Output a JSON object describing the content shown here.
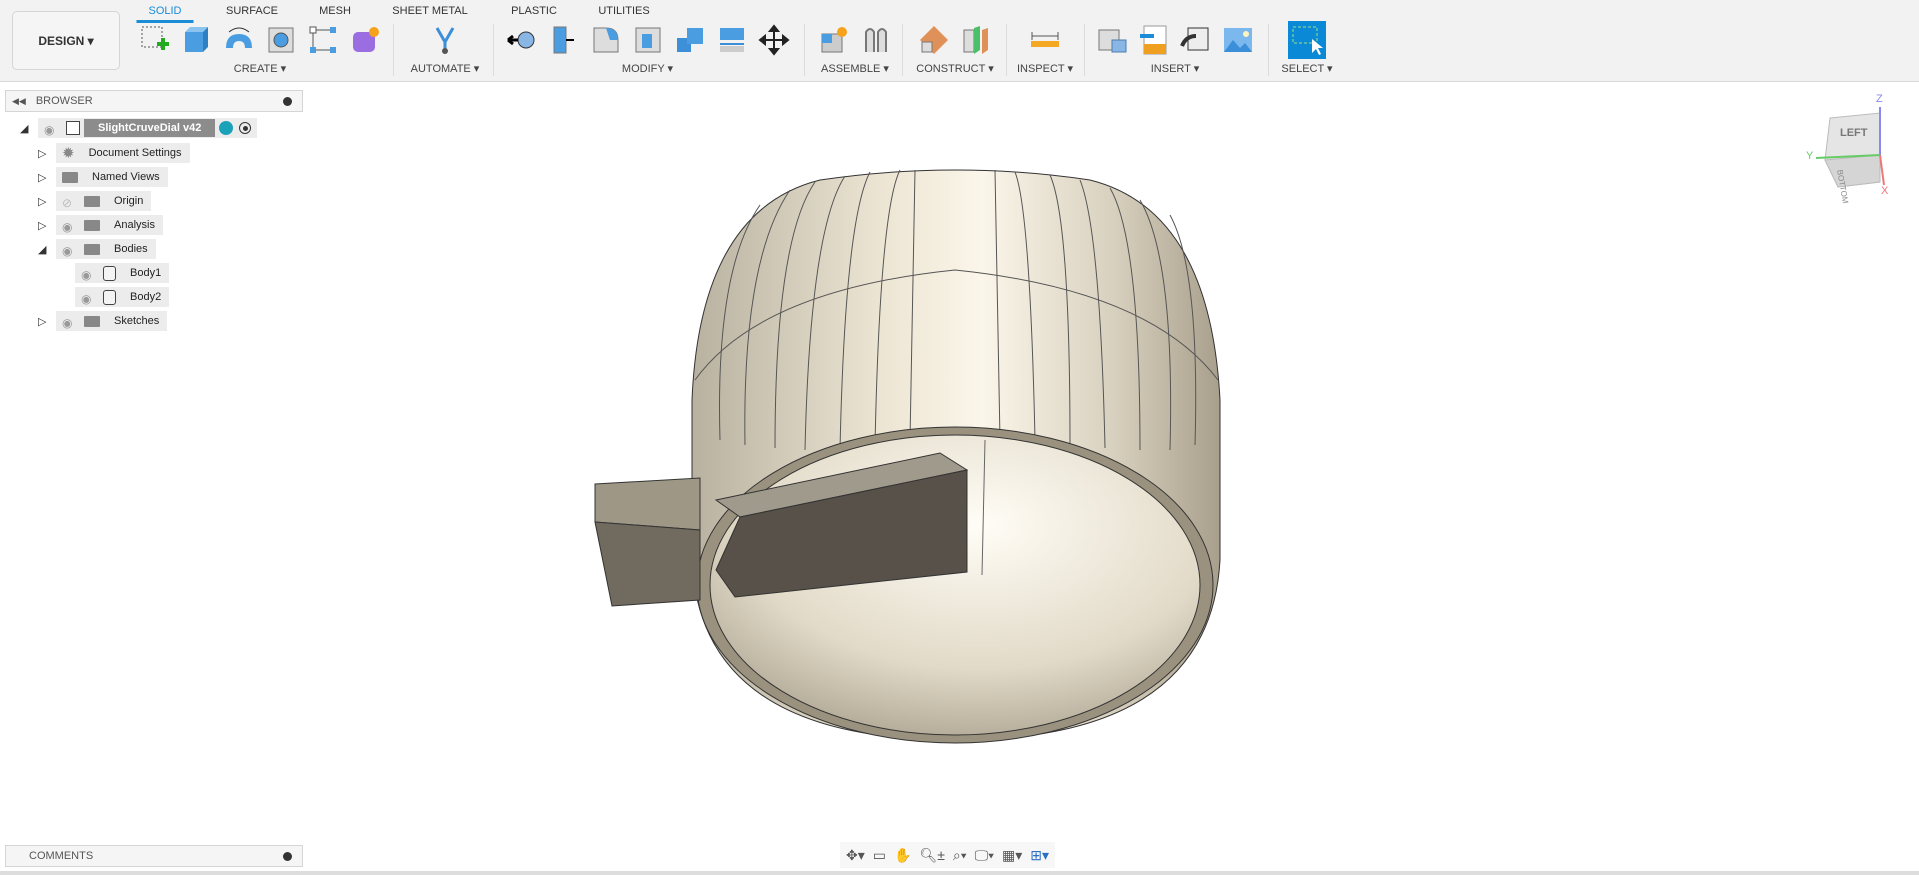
{
  "toolbar": {
    "workspace": "DESIGN ▾",
    "tabs": [
      "SOLID",
      "SURFACE",
      "MESH",
      "SHEET METAL",
      "PLASTIC",
      "UTILITIES"
    ],
    "groups": {
      "create": "CREATE ▾",
      "automate": "AUTOMATE ▾",
      "modify": "MODIFY ▾",
      "assemble": "ASSEMBLE ▾",
      "construct": "CONSTRUCT ▾",
      "inspect": "INSPECT ▾",
      "insert": "INSERT ▾",
      "select": "SELECT ▾"
    },
    "accent": "#1a8cd8"
  },
  "browser": {
    "title": "BROWSER",
    "root": "SlightCruveDial v42",
    "items": [
      {
        "label": "Document Settings",
        "icon": "gear-icon"
      },
      {
        "label": "Named Views",
        "icon": "folder-icon"
      },
      {
        "label": "Origin",
        "icon": "folder-icon"
      },
      {
        "label": "Analysis",
        "icon": "folder-icon"
      },
      {
        "label": "Bodies",
        "icon": "folder-icon"
      },
      {
        "label": "Body1",
        "icon": "body-icon"
      },
      {
        "label": "Body2",
        "icon": "body-icon"
      },
      {
        "label": "Sketches",
        "icon": "folder-icon"
      }
    ]
  },
  "comments": {
    "title": "COMMENTS"
  },
  "viewcube": {
    "face": "LEFT",
    "bottom": "BOTTOM",
    "axes": [
      "X",
      "Y",
      "Z"
    ]
  }
}
